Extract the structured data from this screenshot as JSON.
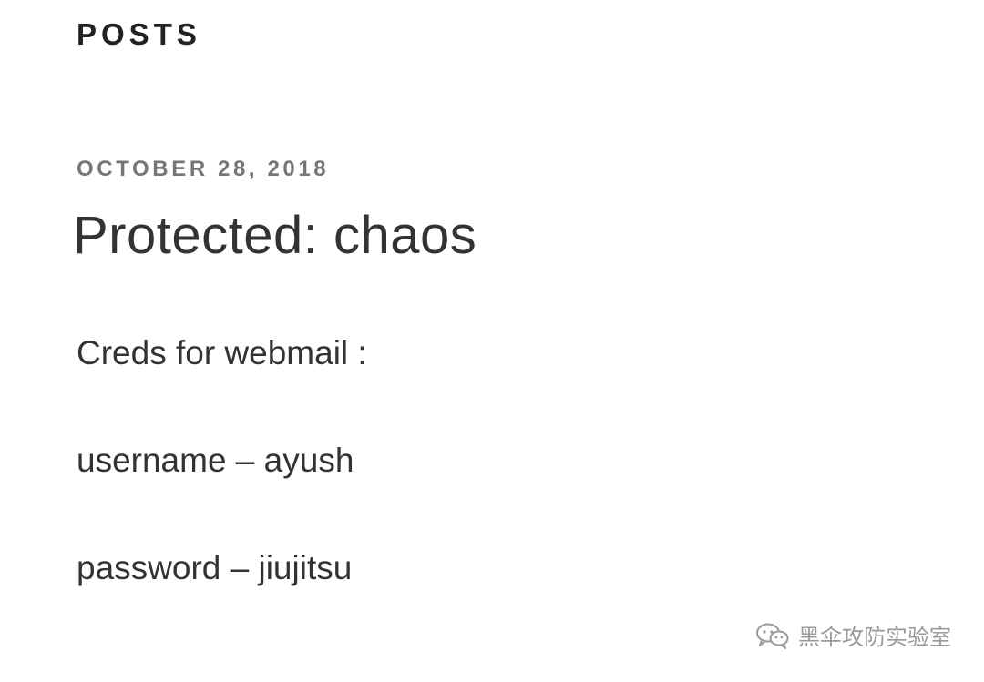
{
  "header": {
    "section_title": "POSTS"
  },
  "post": {
    "date": "OCTOBER 28, 2018",
    "title": "Protected: chaos",
    "content": [
      "Creds for webmail :",
      "username – ayush",
      "password – jiujitsu"
    ]
  },
  "watermark": {
    "text": "黑伞攻防实验室",
    "icon": "wechat-icon"
  },
  "colors": {
    "heading": "#222222",
    "date": "#767676",
    "body": "#333333",
    "watermark": "#9a9a9a"
  }
}
